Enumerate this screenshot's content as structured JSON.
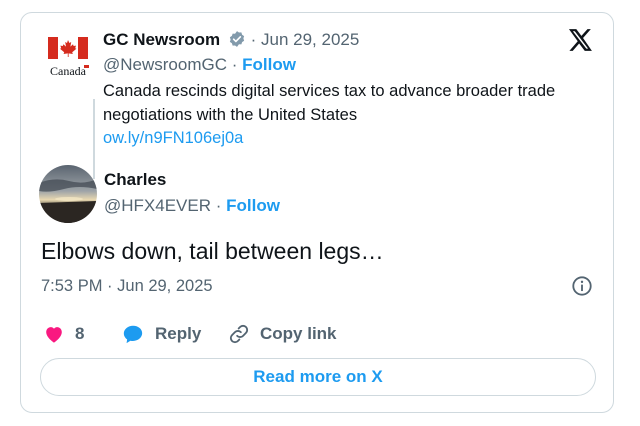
{
  "quoted": {
    "logo_wordmark": "Canada",
    "name": "GC Newsroom",
    "separator": "·",
    "date": "Jun 29, 2025",
    "handle": "@NewsroomGC",
    "follow_label": "Follow",
    "text": "Canada rescinds digital services tax to advance broader trade negotiations with the United States",
    "link": "ow.ly/n9FN106ej0a"
  },
  "author": {
    "name": "Charles",
    "handle": "@HFX4EVER",
    "separator": "·",
    "follow_label": "Follow"
  },
  "tweet": {
    "text": "Elbows down, tail between legs…",
    "time": "7:53 PM",
    "separator": "·",
    "date": "Jun 29, 2025"
  },
  "actions": {
    "like_count": "8",
    "reply_label": "Reply",
    "copy_link_label": "Copy link"
  },
  "read_more_label": "Read more on X",
  "icons": {
    "brand": "x-logo-icon",
    "verified": "verified-badge-icon",
    "info": "info-icon",
    "like": "heart-icon",
    "reply": "speech-bubble-icon",
    "copy": "link-icon"
  },
  "colors": {
    "accent": "#1d9bf0",
    "like": "#f91880",
    "muted": "#536471",
    "text": "#0f1419",
    "border": "#cfd9de",
    "canada_red": "#d52b1e"
  }
}
